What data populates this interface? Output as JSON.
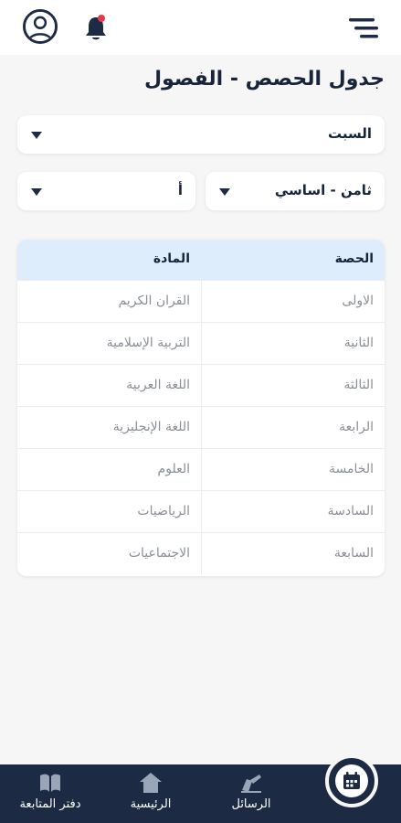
{
  "header": {
    "title": "جدول الحصص - الفصول"
  },
  "filters": {
    "day": "السبت",
    "grade": "ثامن - اساسي",
    "section": "أ"
  },
  "table": {
    "headers": {
      "period": "الحصة",
      "subject": "المادة"
    },
    "rows": [
      {
        "period": "الاولى",
        "subject": "القران الكريم"
      },
      {
        "period": "الثانية",
        "subject": "التربية الإسلامية"
      },
      {
        "period": "الثالثة",
        "subject": "اللغة العربية"
      },
      {
        "period": "الرابعة",
        "subject": "اللغة الإنجليزية"
      },
      {
        "period": "الخامسة",
        "subject": "العلوم"
      },
      {
        "period": "السادسة",
        "subject": "الرياضيات"
      },
      {
        "period": "السابعة",
        "subject": "الاجتماعيات"
      }
    ]
  },
  "bottom_nav": {
    "followup": "دفتر المتابعة",
    "home": "الرئيسية",
    "messages": "الرسائل"
  },
  "icons": {
    "profile": "user-avatar-icon",
    "notifications": "bell-icon",
    "menu": "menu-icon",
    "followup": "book-icon",
    "home": "home-icon",
    "messages": "write-icon",
    "schedule": "calendar-icon"
  },
  "colors": {
    "primary": "#1c2b43",
    "table_header": "#ddedfb",
    "notification_dot": "#e8394a"
  }
}
